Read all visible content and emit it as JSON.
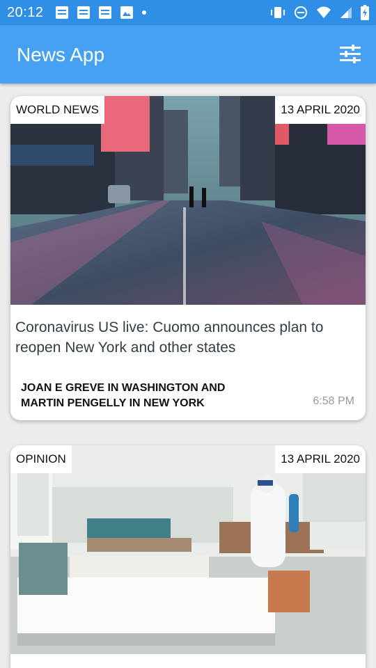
{
  "status_bar": {
    "time": "20:12",
    "left_icons": [
      "notification-icon",
      "notification-icon",
      "notification-icon",
      "gallery-icon",
      "dot-icon"
    ],
    "right_icons": [
      "vibrate-icon",
      "do-not-disturb-icon",
      "wifi-icon",
      "signal-icon",
      "battery-icon"
    ]
  },
  "app_bar": {
    "title": "News App",
    "filter_icon": "filter-sliders-icon",
    "color": "#47a1f2"
  },
  "articles": [
    {
      "category": "WORLD NEWS",
      "date": "13 APRIL 2020",
      "title": "Coronavirus US live: Cuomo announces plan to reopen New York and other states",
      "author": "JOAN E GREVE IN WASHINGTON AND MARTIN PENGELLY IN NEW YORK",
      "time": "6:58 PM",
      "image": "empty-city-street-photo"
    },
    {
      "category": "OPINION",
      "date": "13 APRIL 2020",
      "image": "hospital-ward-photo"
    }
  ]
}
